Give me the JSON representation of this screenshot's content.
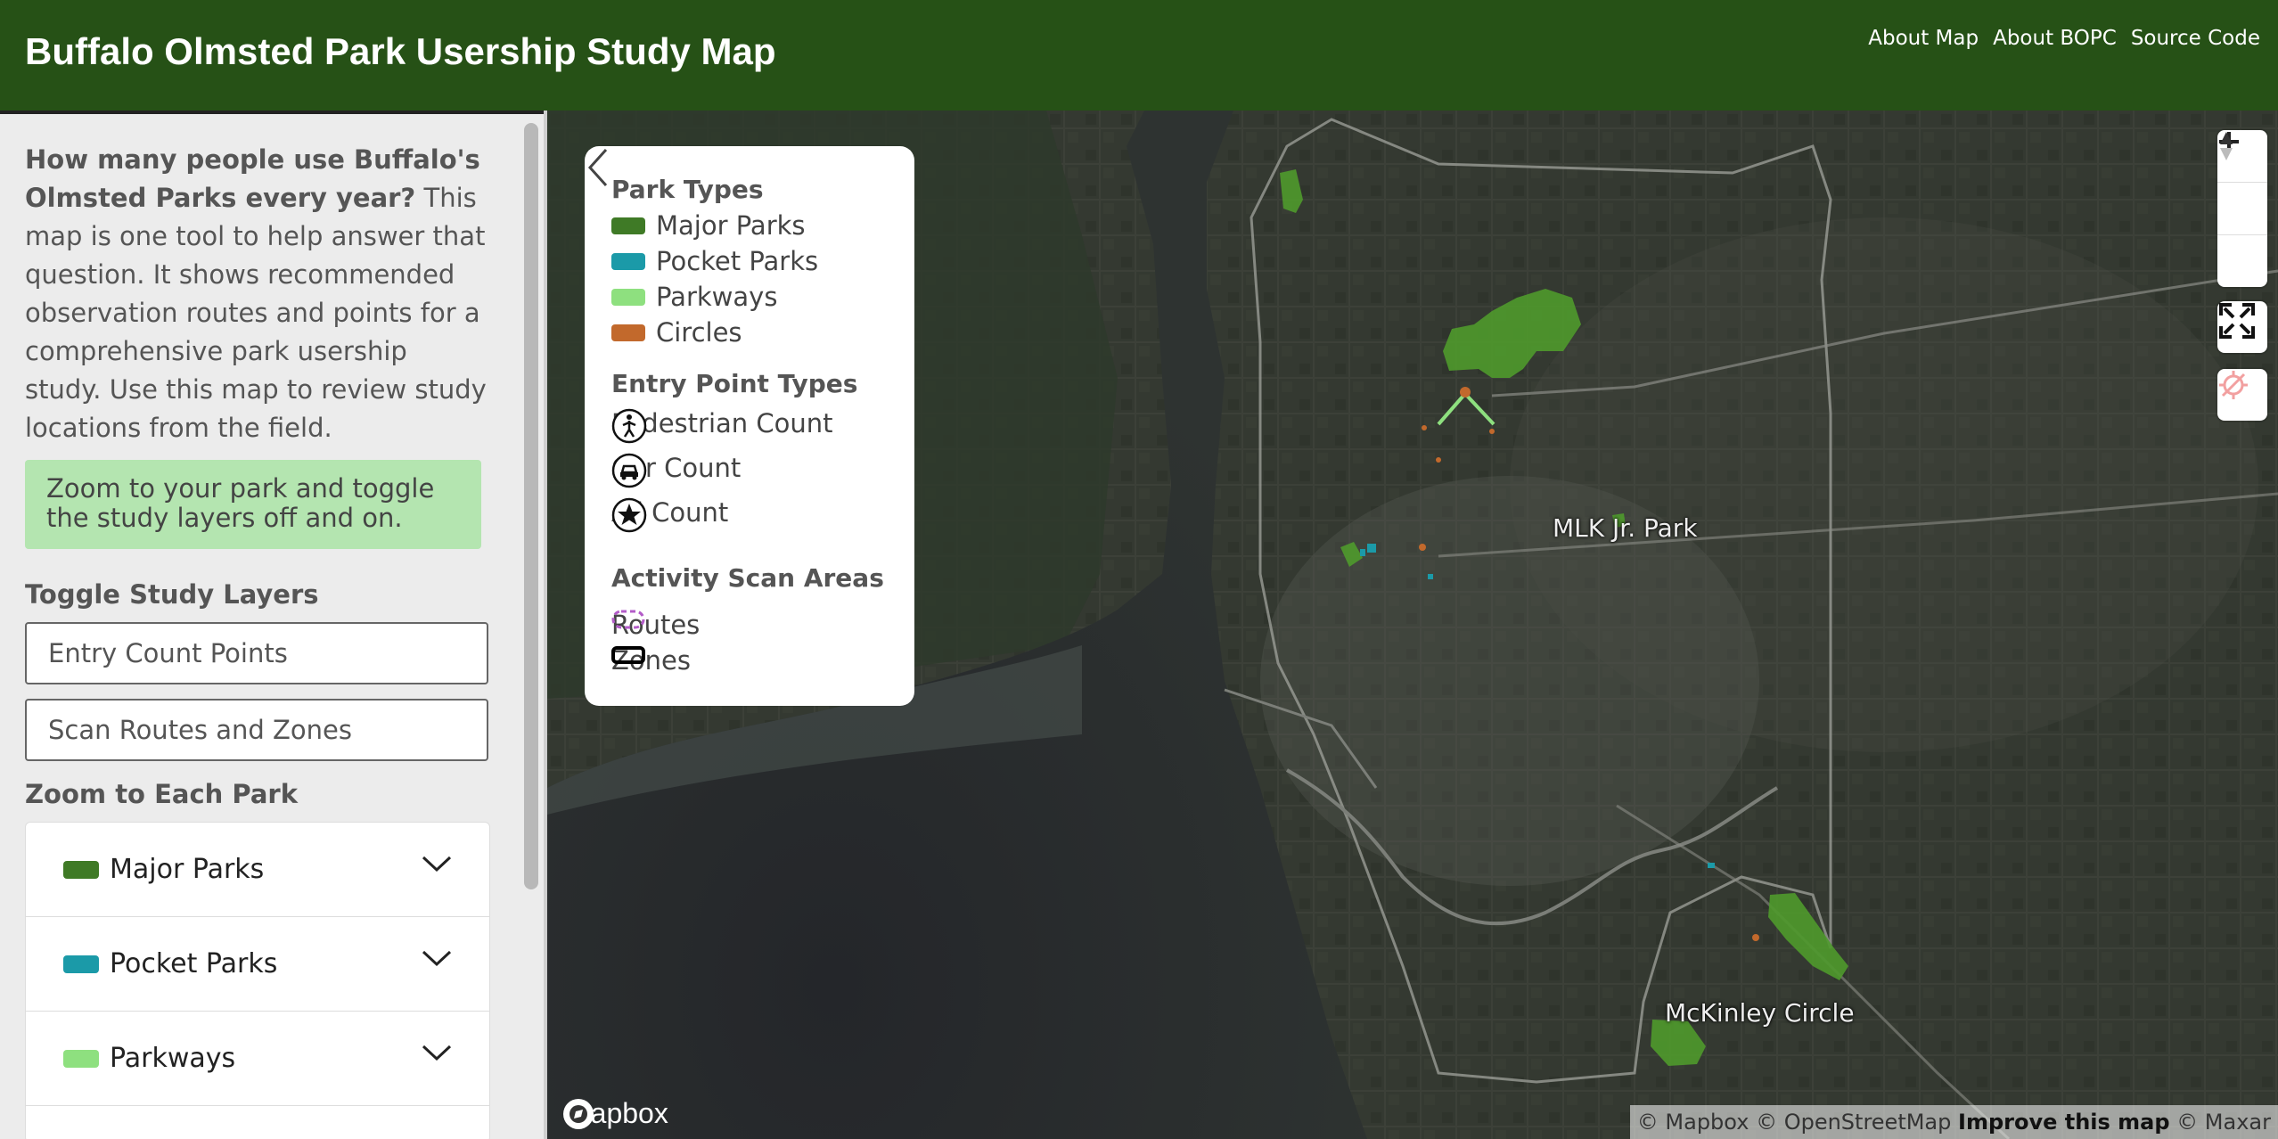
{
  "header": {
    "title": "Buffalo Olmsted Park Usership Study Map",
    "links": [
      "About Map",
      "About BOPC",
      "Source Code"
    ]
  },
  "sidebar": {
    "intro_bold": "How many people use Buffalo's Olmsted Parks every year?",
    "intro_text": " This map is one tool to help answer that question. It shows recommended observation routes and points for a comprehensive park usership study. Use this map to review study locations from the field.",
    "tip": "Zoom to your park and toggle the study layers off and on.",
    "toggle_heading": "Toggle Study Layers",
    "toggle_buttons": [
      "Entry Count Points",
      "Scan Routes and Zones"
    ],
    "zoom_heading": "Zoom to Each Park",
    "park_groups": [
      {
        "label": "Major Parks",
        "color": "#3f7a26"
      },
      {
        "label": "Pocket Parks",
        "color": "#1b9aa8"
      },
      {
        "label": "Parkways",
        "color": "#8ee07f"
      }
    ]
  },
  "legend": {
    "park_types_heading": "Park Types",
    "park_types": [
      {
        "label": "Major Parks",
        "color": "#3f7a26"
      },
      {
        "label": "Pocket Parks",
        "color": "#1b9aa8"
      },
      {
        "label": "Parkways",
        "color": "#8ee07f"
      },
      {
        "label": "Circles",
        "color": "#c2692c"
      }
    ],
    "entry_heading": "Entry Point Types",
    "entry_types": [
      {
        "label": "Pedestrian Count",
        "icon": "pedestrian-icon"
      },
      {
        "label": "Car Count",
        "icon": "car-icon"
      },
      {
        "label": "All Count",
        "icon": "star-icon"
      }
    ],
    "scan_heading": "Activity Scan Areas",
    "scan_types": [
      {
        "label": "Routes",
        "icon": "dashed-route-icon",
        "color": "#b35cc8"
      },
      {
        "label": "Zones",
        "icon": "zone-outline-icon",
        "color": "#000000"
      }
    ]
  },
  "map": {
    "labels": [
      "MLK Jr. Park",
      "McKinley Circle"
    ],
    "logo": "mapbox",
    "attribution": {
      "prefix": "© Mapbox © OpenStreetMap ",
      "improve": "Improve this map",
      "suffix": " © Maxar"
    },
    "colors": {
      "header": "#265116",
      "park": "#4f9a2c"
    }
  }
}
